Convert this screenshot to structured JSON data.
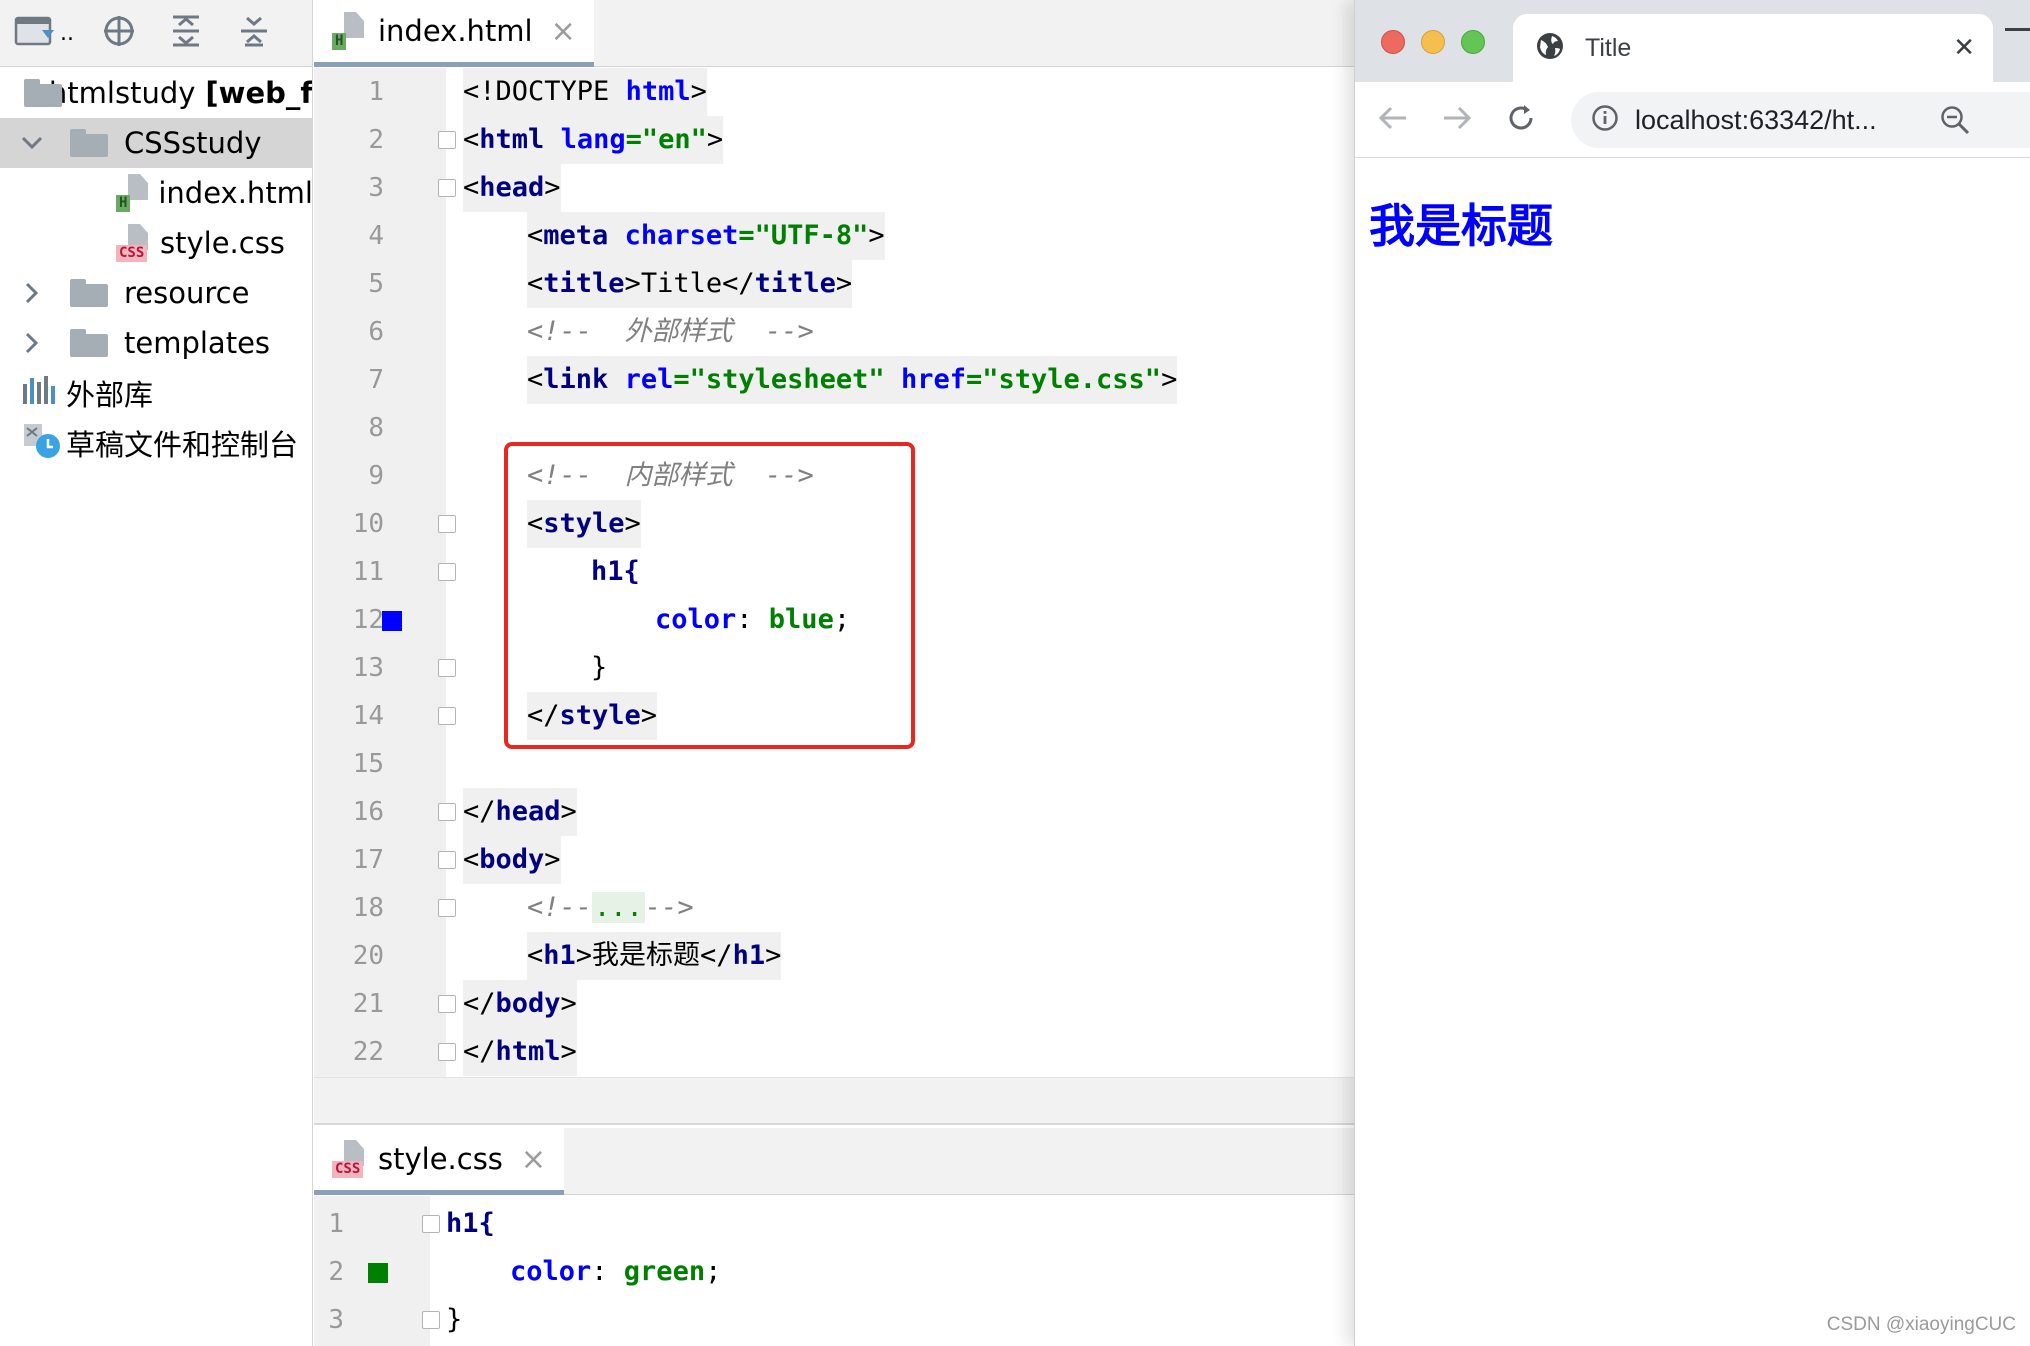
{
  "project": {
    "items": [
      {
        "label": "htmlstudy",
        "suffix": "[web_f"
      },
      {
        "label": "CSSstudy"
      },
      {
        "label": "index.html"
      },
      {
        "label": "style.css"
      },
      {
        "label": "resource"
      },
      {
        "label": "templates"
      },
      {
        "label": "外部库"
      },
      {
        "label": "草稿文件和控制台"
      }
    ],
    "ellipsis": ".."
  },
  "editor": {
    "tab_label": "index.html",
    "tab_close": "×",
    "lines": [
      {
        "n": "1"
      },
      {
        "n": "2"
      },
      {
        "n": "3"
      },
      {
        "n": "4"
      },
      {
        "n": "5"
      },
      {
        "n": "6"
      },
      {
        "n": "7"
      },
      {
        "n": "8"
      },
      {
        "n": "9"
      },
      {
        "n": "10"
      },
      {
        "n": "11"
      },
      {
        "n": "12"
      },
      {
        "n": "13"
      },
      {
        "n": "14"
      },
      {
        "n": "15"
      },
      {
        "n": "16"
      },
      {
        "n": "17"
      },
      {
        "n": "18"
      },
      {
        "n": "20"
      },
      {
        "n": "21"
      },
      {
        "n": "22"
      }
    ],
    "tokens": {
      "doctype": "<!DOCTYPE ",
      "html": "html",
      "lt": "<",
      "gt": ">",
      "lang": "lang",
      "eq": "=",
      "en": "\"en\"",
      "head": "head",
      "meta": "meta",
      "charset": "charset",
      "utf8": "\"UTF-8\"",
      "title": "title",
      "title_text": "Title",
      "close_lt": "</",
      "comment_external": "<!--  外部样式  -->",
      "link": "link",
      "rel": "rel",
      "stylesheet": "\"stylesheet\"",
      "href": "href",
      "stylecss": "\"style.css\"",
      "comment_internal": "<!--  内部样式  -->",
      "style": "style",
      "h1_sel": "h1{",
      "color": "color",
      "colon": ": ",
      "blue": "blue",
      "semi": ";",
      "rbrace": "}",
      "body": "body",
      "comment_open": "<!--",
      "dots": "...",
      "comment_close": "-->",
      "h1": "h1",
      "h1_text": "我是标题",
      "space": " "
    },
    "gutter_swatch": "#0000ff"
  },
  "editor2": {
    "tab_label": "style.css",
    "tab_close": "×",
    "lines": [
      {
        "n": "1"
      },
      {
        "n": "2"
      },
      {
        "n": "3"
      }
    ],
    "tokens": {
      "h1_sel": "h1{",
      "color": "color",
      "colon": ": ",
      "green": "green",
      "semi": ";",
      "rbrace": "}"
    },
    "gutter_swatch": "#008000"
  },
  "browser": {
    "tab_title": "Title",
    "tab_close": "✕",
    "url": "localhost:63342/ht...",
    "heading": "我是标题",
    "heading_color": "#0000ff"
  },
  "watermark": "CSDN @xiaoyingCUC"
}
